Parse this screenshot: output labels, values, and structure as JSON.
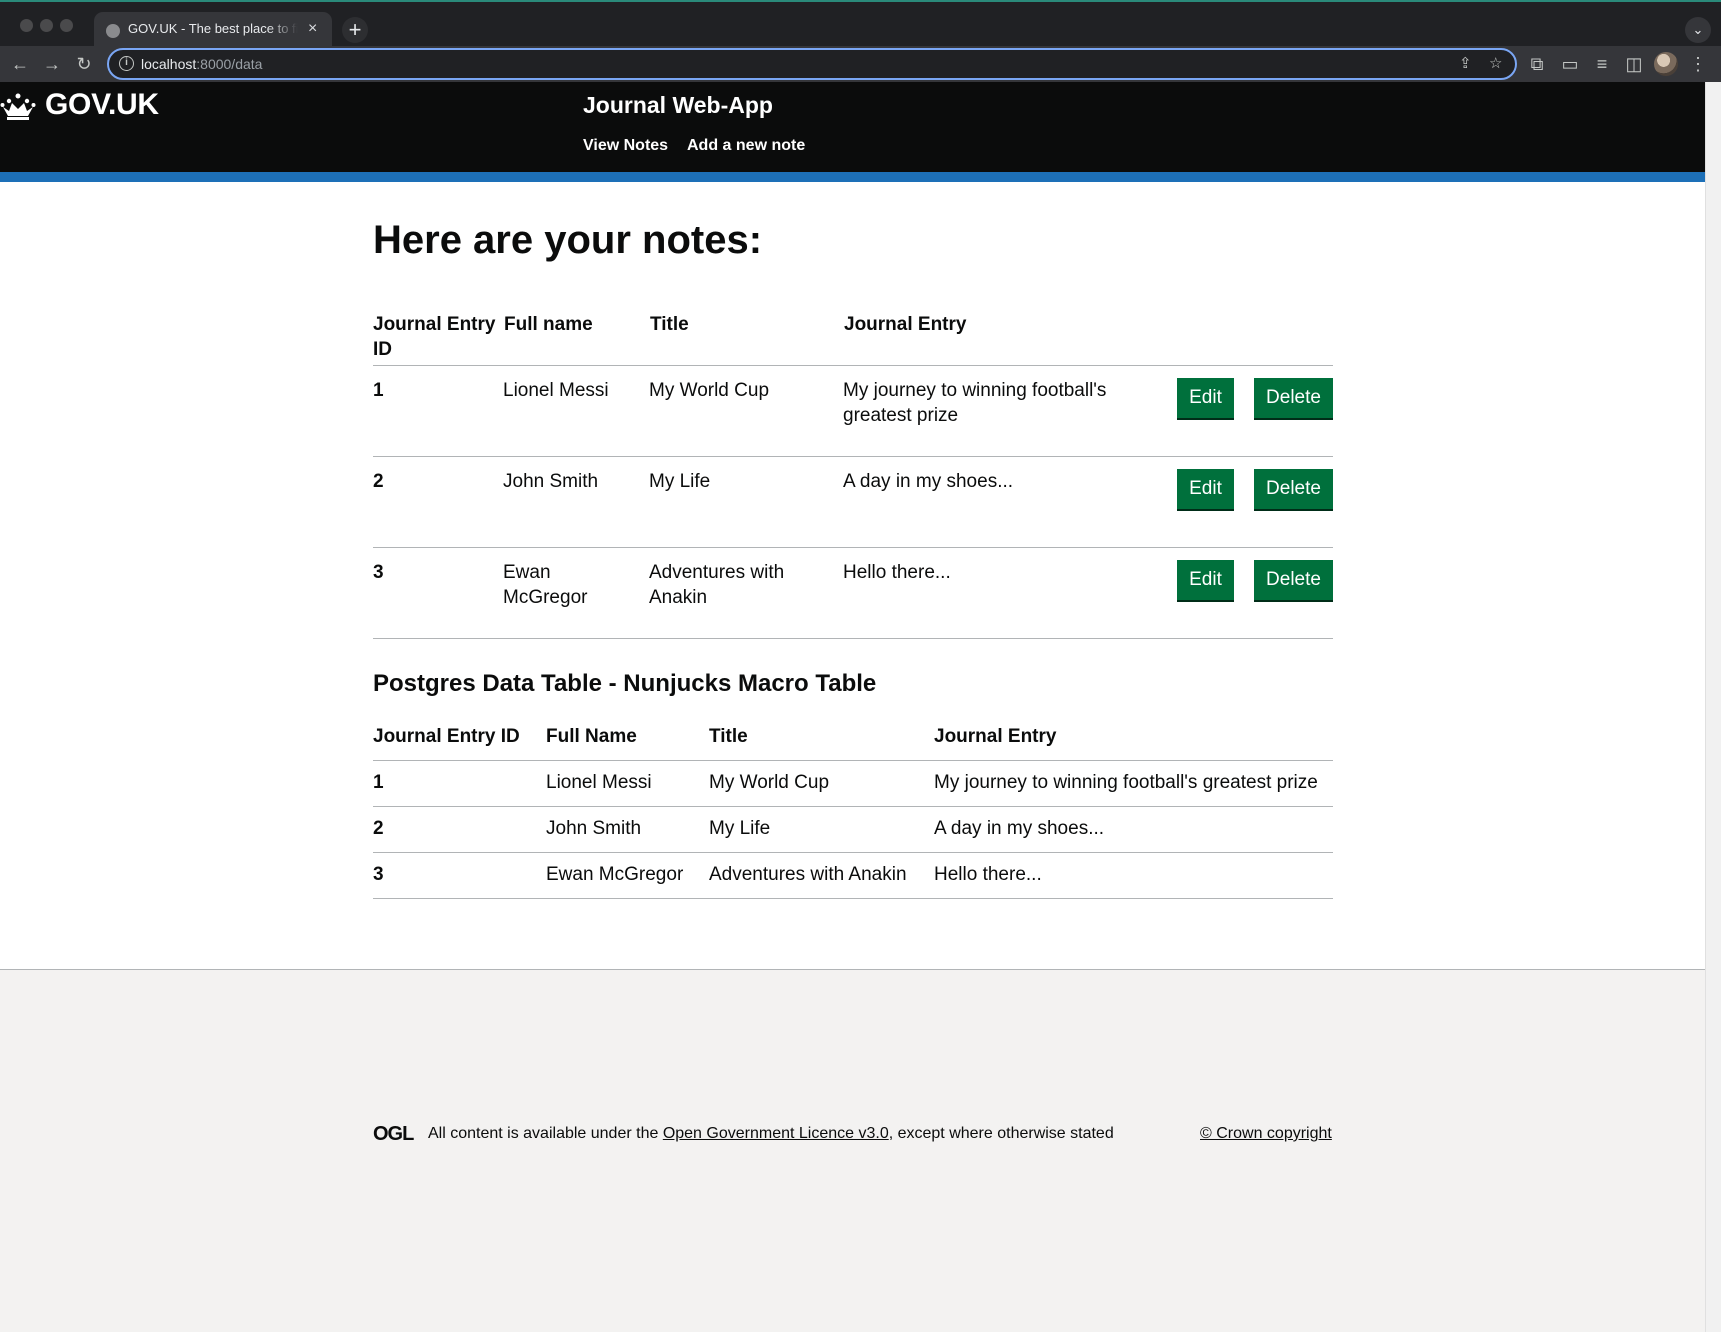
{
  "browser": {
    "tab_title": "GOV.UK - The best place to find government services and information",
    "tab_close": "×",
    "new_tab": "+",
    "url_host": "localhost",
    "url_path": ":8000/data"
  },
  "header": {
    "logo_text": "GOV.UK",
    "service_name": "Journal Web-App",
    "nav": [
      {
        "label": "View Notes"
      },
      {
        "label": "Add a new note"
      }
    ]
  },
  "notes": {
    "heading": "Here are your notes:",
    "columns": [
      "Journal Entry ID",
      "Full name",
      "Title",
      "Journal Entry"
    ],
    "rows": [
      {
        "id": "1",
        "name": "Lionel Messi",
        "title": "My World Cup",
        "entry": "My journey to winning football's greatest prize"
      },
      {
        "id": "2",
        "name": "John Smith",
        "title": "My Life",
        "entry": "A day in my shoes..."
      },
      {
        "id": "3",
        "name": "Ewan McGregor",
        "title": "Adventures with Anakin",
        "entry": "Hello there..."
      }
    ],
    "edit_label": "Edit",
    "delete_label": "Delete"
  },
  "macro_table": {
    "heading": "Postgres Data Table - Nunjucks Macro Table",
    "columns": [
      "Journal Entry ID",
      "Full Name",
      "Title",
      "Journal Entry"
    ],
    "rows": [
      {
        "id": "1",
        "name": "Lionel Messi",
        "title": "My World Cup",
        "entry": "My journey to winning football's greatest prize"
      },
      {
        "id": "2",
        "name": "John Smith",
        "title": "My Life",
        "entry": "A day in my shoes..."
      },
      {
        "id": "3",
        "name": "Ewan McGregor",
        "title": "Adventures with Anakin",
        "entry": "Hello there..."
      }
    ]
  },
  "footer": {
    "ogl_logo": "OGL",
    "licence_prefix": "All content is available under the ",
    "licence_link": "Open Government Licence v3.0",
    "licence_suffix": ", except where otherwise stated",
    "copyright": "© Crown copyright"
  },
  "colors": {
    "header_bg": "#0b0c0c",
    "header_stripe": "#1d70b8",
    "button_green": "#00703c",
    "footer_bg": "#f3f2f1"
  },
  "icons": [
    "crown-icon",
    "back-icon",
    "forward-icon",
    "reload-icon",
    "info-icon",
    "share-icon",
    "bookmark-star-icon",
    "extensions-icon",
    "cast-icon",
    "reading-list-icon",
    "side-panel-icon",
    "menu-icon"
  ]
}
